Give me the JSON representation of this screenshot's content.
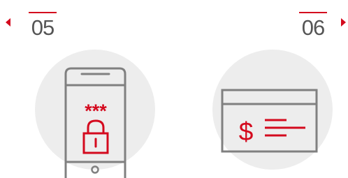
{
  "nav": {
    "prev_icon": "caret-left-icon",
    "next_icon": "caret-right-icon"
  },
  "steps": [
    {
      "number": "05",
      "icon": "phone-password-lock-icon",
      "password_mask": "***"
    },
    {
      "number": "06",
      "icon": "card-dollar-icon",
      "currency_symbol": "$"
    }
  ],
  "colors": {
    "accent": "#d40a1e",
    "outline": "#808080",
    "circle_bg": "#ededed",
    "number_text": "#555555"
  }
}
